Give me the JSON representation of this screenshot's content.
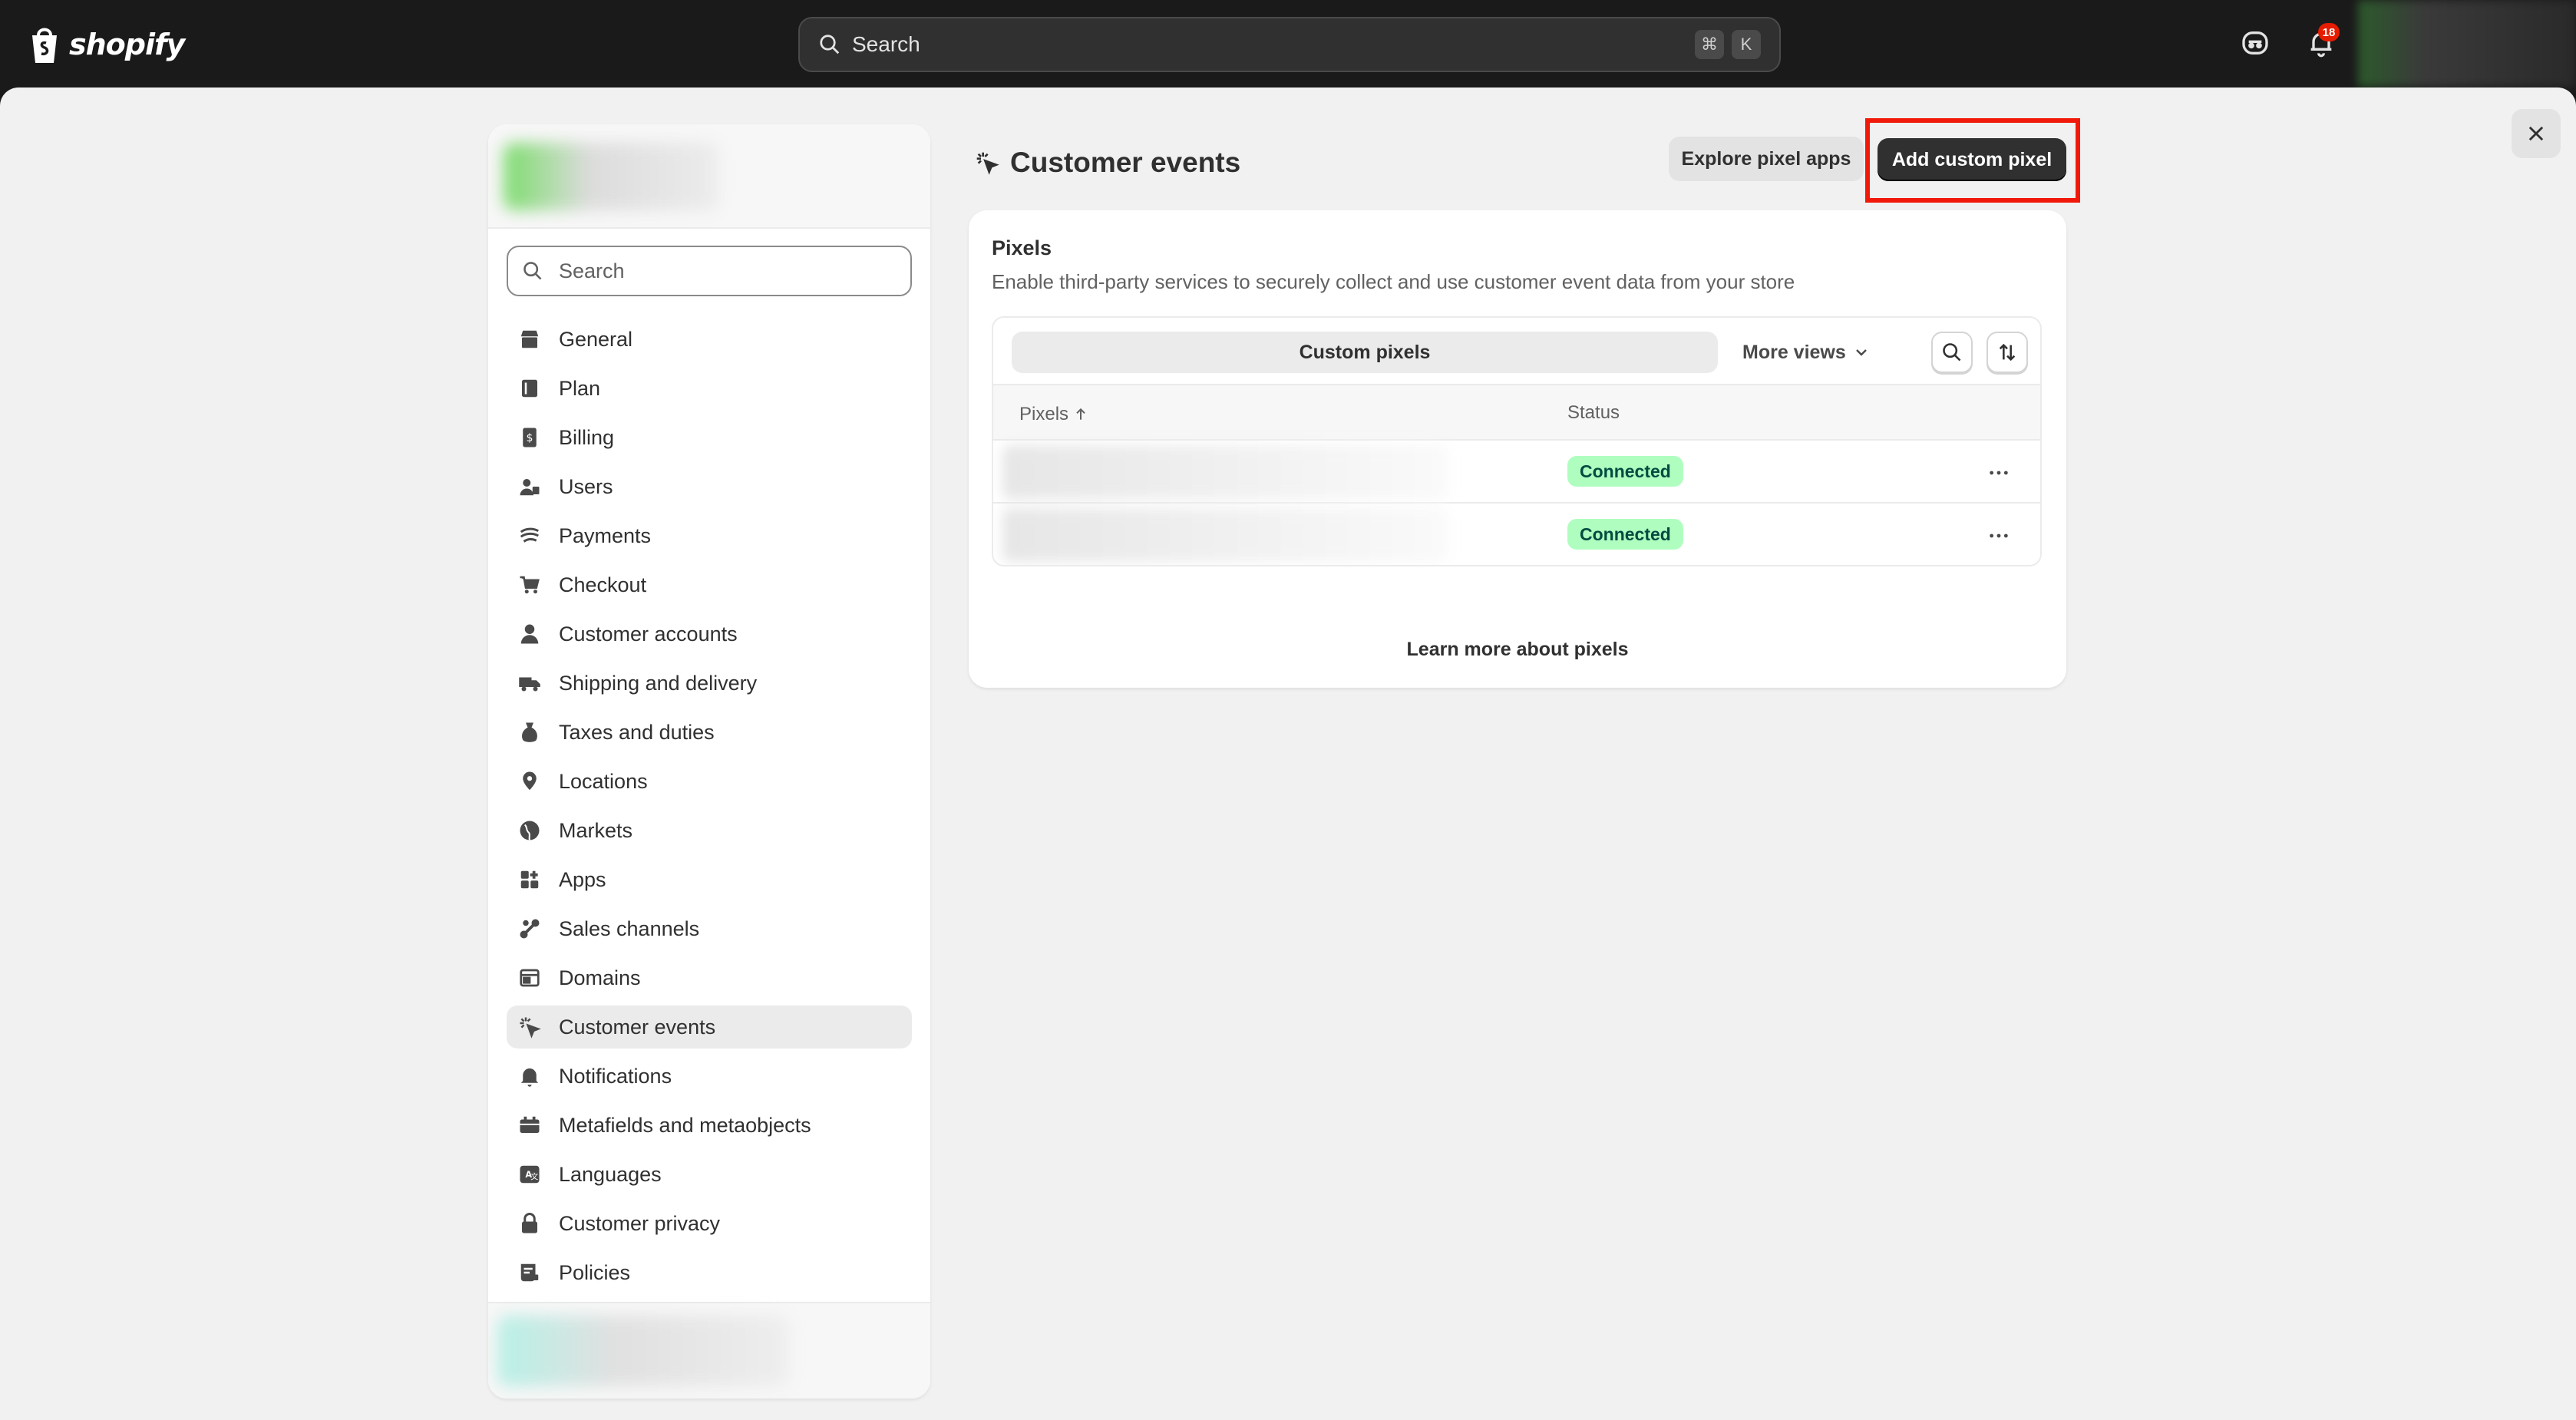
{
  "topbar": {
    "brand": "shopify",
    "search_placeholder": "Search",
    "shortcut_keys": [
      "⌘",
      "K"
    ],
    "notification_count": "18"
  },
  "sidebar": {
    "search_placeholder": "Search",
    "items": [
      {
        "label": "General",
        "icon": "store-icon"
      },
      {
        "label": "Plan",
        "icon": "plan-icon"
      },
      {
        "label": "Billing",
        "icon": "billing-icon"
      },
      {
        "label": "Users",
        "icon": "users-icon"
      },
      {
        "label": "Payments",
        "icon": "payments-icon"
      },
      {
        "label": "Checkout",
        "icon": "cart-icon"
      },
      {
        "label": "Customer accounts",
        "icon": "person-icon"
      },
      {
        "label": "Shipping and delivery",
        "icon": "truck-icon"
      },
      {
        "label": "Taxes and duties",
        "icon": "tax-icon"
      },
      {
        "label": "Locations",
        "icon": "location-icon"
      },
      {
        "label": "Markets",
        "icon": "globe-icon"
      },
      {
        "label": "Apps",
        "icon": "apps-icon"
      },
      {
        "label": "Sales channels",
        "icon": "channels-icon"
      },
      {
        "label": "Domains",
        "icon": "domains-icon"
      },
      {
        "label": "Customer events",
        "icon": "cursor-sparkle-icon",
        "active": true
      },
      {
        "label": "Notifications",
        "icon": "bell-icon"
      },
      {
        "label": "Metafields and metaobjects",
        "icon": "metafields-icon"
      },
      {
        "label": "Languages",
        "icon": "language-icon"
      },
      {
        "label": "Customer privacy",
        "icon": "lock-icon"
      },
      {
        "label": "Policies",
        "icon": "policies-icon"
      }
    ]
  },
  "page": {
    "title": "Customer events",
    "explore_button": "Explore pixel apps",
    "add_button": "Add custom pixel"
  },
  "pixels_card": {
    "title": "Pixels",
    "description": "Enable third-party services to securely collect and use customer event data from your store",
    "tab_active": "Custom pixels",
    "more_views": "More views",
    "columns": {
      "pixels": "Pixels",
      "status": "Status"
    },
    "rows": [
      {
        "status": "Connected"
      },
      {
        "status": "Connected"
      }
    ]
  },
  "footer_link": "Learn more about pixels",
  "colors": {
    "topbar": "#1a1a1a",
    "primary_button": "#303030",
    "highlight": "#f11a0a",
    "badge_bg": "#affebf",
    "badge_text": "#014b40"
  }
}
